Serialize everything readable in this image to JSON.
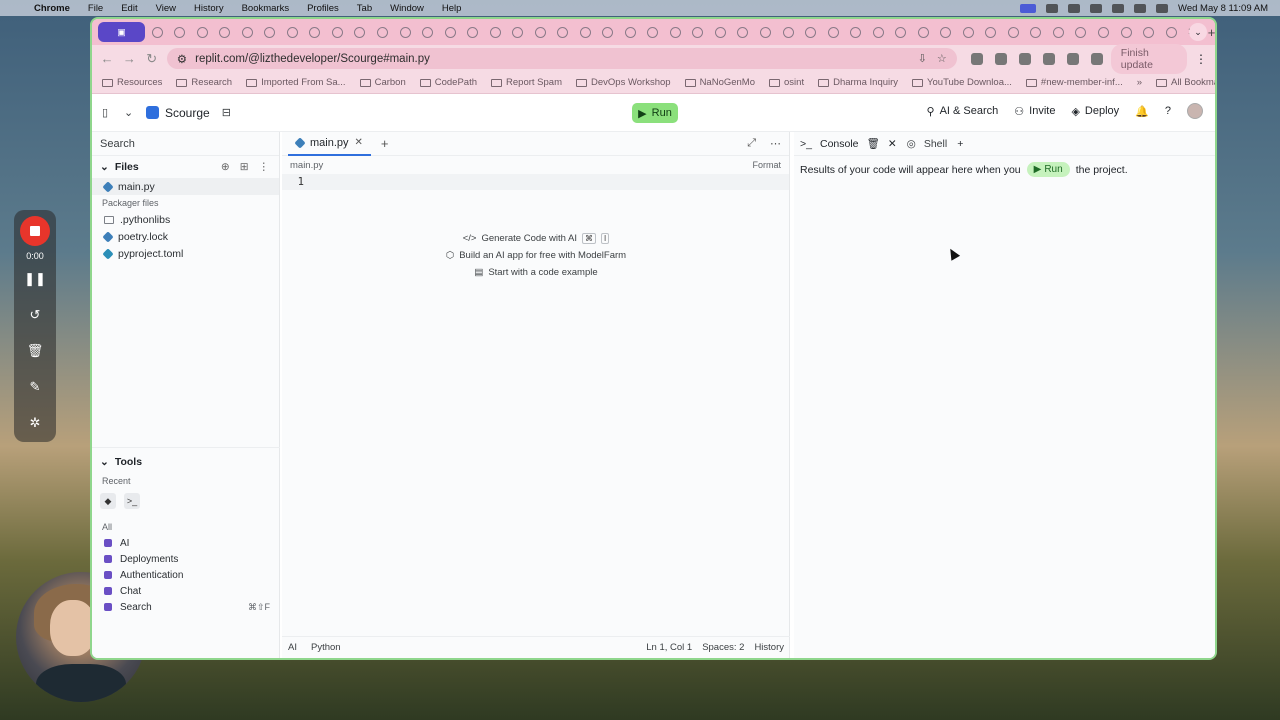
{
  "menubar": {
    "app": "Chrome",
    "items": [
      "File",
      "Edit",
      "View",
      "History",
      "Bookmarks",
      "Profiles",
      "Tab",
      "Window",
      "Help"
    ],
    "datetime": "Wed May 8  11:09 AM"
  },
  "recorder": {
    "time": "0:00"
  },
  "browser": {
    "url": "replit.com/@lizthedeveloper/Scourge#main.py",
    "finish_update": "Finish update",
    "bookmarks": [
      "Resources",
      "Research",
      "Imported From Sa...",
      "Carbon",
      "CodePath",
      "Report Spam",
      "DevOps Workshop",
      "NaNoGenMo",
      "osint",
      "Dharma Inquiry",
      "YouTube Downloa...",
      "#new-member-inf..."
    ],
    "all_bookmarks": "All Bookmarks"
  },
  "app": {
    "repl_name": "Scourge",
    "run_label": "Run",
    "header_buttons": {
      "ai_search": "AI & Search",
      "invite": "Invite",
      "deploy": "Deploy"
    },
    "left": {
      "search": "Search",
      "files_header": "Files",
      "files": [
        "main.py"
      ],
      "packager_label": "Packager files",
      "packager_files": [
        ".pythonlibs",
        "poetry.lock",
        "pyproject.toml"
      ],
      "tools_header": "Tools",
      "recent_label": "Recent",
      "all_label": "All",
      "tools": [
        "AI",
        "Deployments",
        "Authentication",
        "Chat",
        "Search"
      ],
      "search_shortcut": "⌘⇧F"
    },
    "editor": {
      "tab": "main.py",
      "breadcrumb": "main.py",
      "format": "Format",
      "line_number": "1",
      "actions": {
        "generate": "Generate Code with AI",
        "generate_kbd1": "⌘",
        "generate_kbd2": "I",
        "modelfarm": "Build an AI app for free with ModelFarm",
        "example": "Start with a code example"
      },
      "status": {
        "ai": "AI",
        "language": "Python",
        "position": "Ln 1, Col 1",
        "spaces": "Spaces: 2",
        "history": "History"
      }
    },
    "console": {
      "tab_console": "Console",
      "tab_shell": "Shell",
      "message_pre": "Results of your code will appear here when you",
      "run_chip": "Run",
      "message_post": "the project."
    }
  }
}
